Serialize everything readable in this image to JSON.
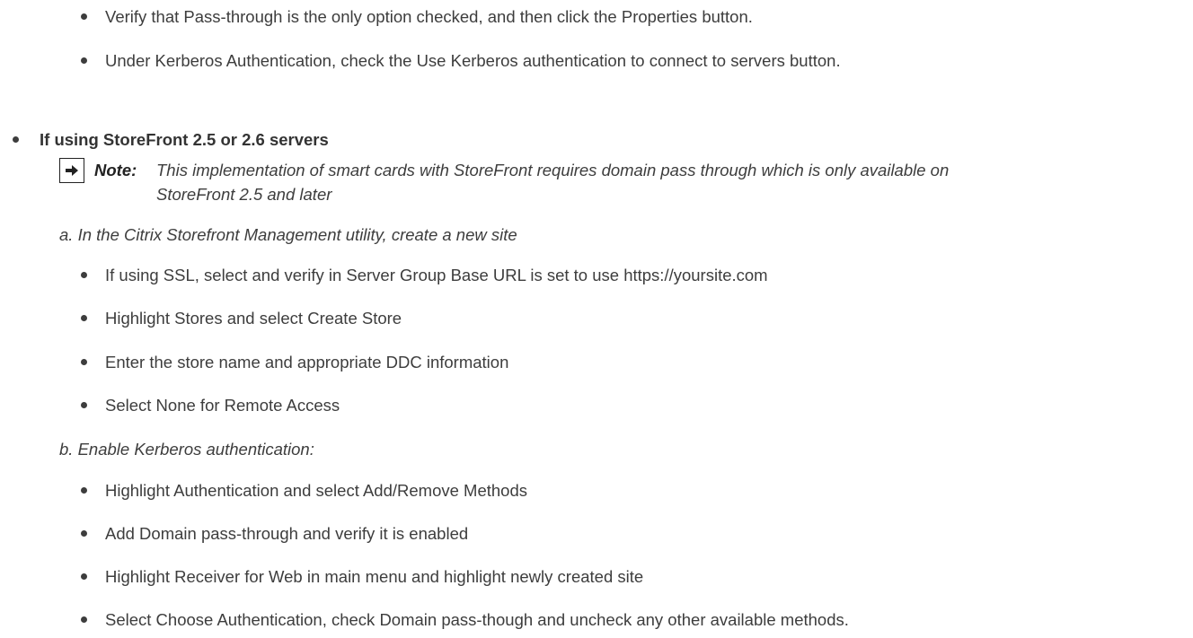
{
  "top_bullets": [
    "Verify that Pass-through is the only option checked, and then click the Properties button.",
    "Under Kerberos Authentication, check the Use Kerberos authentication to connect to servers button."
  ],
  "section_heading": "If using StoreFront 2.5 or 2.6 servers",
  "note": {
    "label": "Note:",
    "line1": "This implementation of smart cards with StoreFront requires domain pass through which is only available on",
    "line2": "StoreFront 2.5 and later",
    "icon": "arrow-right-icon"
  },
  "step_a": {
    "heading": "a.  In the Citrix Storefront Management utility, create a new site",
    "items": [
      "If using SSL, select and verify in Server Group Base URL is set to use https://yoursite.com",
      "Highlight Stores and select Create Store",
      "Enter the store name and appropriate DDC information",
      "Select None for Remote Access"
    ]
  },
  "step_b": {
    "heading": "b.  Enable Kerberos authentication:",
    "items": [
      "Highlight Authentication and select Add/Remove Methods",
      "Add Domain pass-through and verify it is enabled",
      "Highlight Receiver for Web in main menu and highlight newly created site",
      "Select Choose Authentication, check Domain pass-though and uncheck any other available methods."
    ]
  }
}
